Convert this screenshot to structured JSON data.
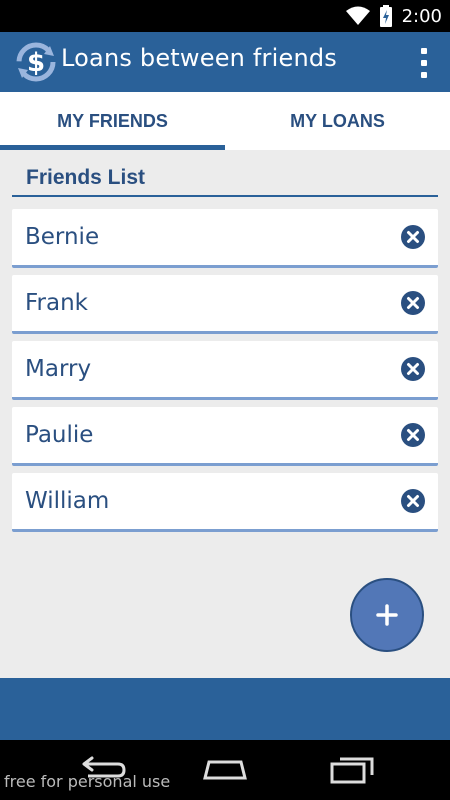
{
  "status_bar": {
    "time": "2:00"
  },
  "app_bar": {
    "title": "Loans between friends"
  },
  "tabs": [
    {
      "label": "MY FRIENDS",
      "active": true
    },
    {
      "label": "MY LOANS",
      "active": false
    }
  ],
  "friends": {
    "heading": "Friends List",
    "items": [
      {
        "name": "Bernie"
      },
      {
        "name": "Frank"
      },
      {
        "name": "Marry"
      },
      {
        "name": "Paulie"
      },
      {
        "name": "William"
      }
    ]
  },
  "nav_bar": {
    "watermark": "free for personal use"
  },
  "colors": {
    "primary": "#2a6199",
    "accent_text": "#2a4f80",
    "fab": "#5277b7"
  },
  "icons": {
    "app_logo": "dollar-refresh-icon",
    "menu": "overflow-menu-icon",
    "delete": "close-circle-icon",
    "add": "plus-icon"
  }
}
